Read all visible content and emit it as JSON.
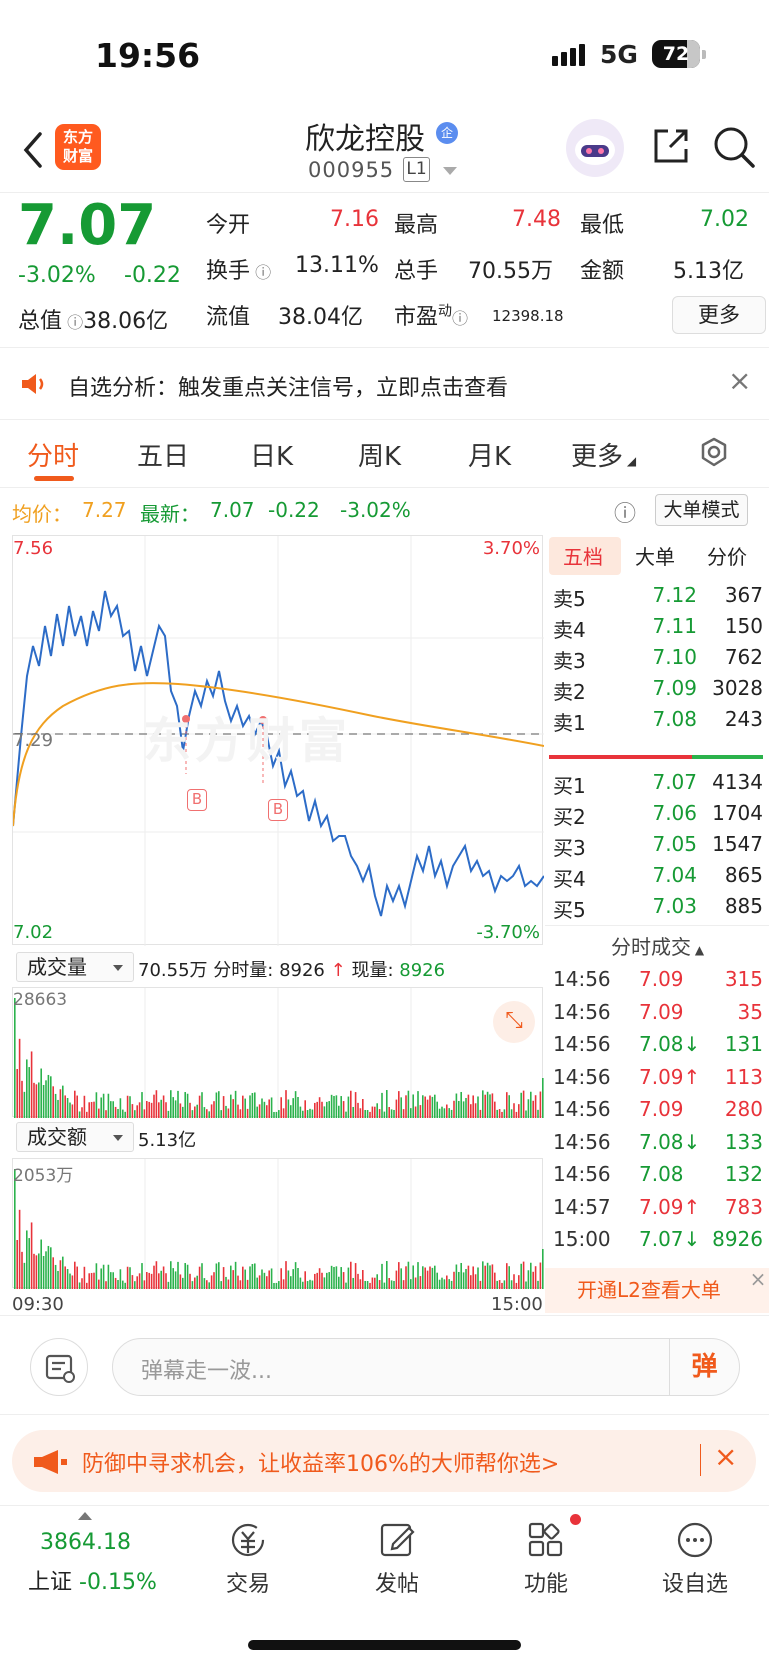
{
  "status_bar": {
    "time": "19:56",
    "network": "5G",
    "battery": "72"
  },
  "header": {
    "logo_text_1": "东方",
    "logo_text_2": "财富",
    "stock_name": "欣龙控股",
    "badge": "企",
    "stock_code": "000955",
    "level": "L1"
  },
  "quote": {
    "price": "7.07",
    "pct": "-3.02%",
    "change": "-0.22",
    "total_label": "总值",
    "total_value": "38.06亿",
    "open_label": "今开",
    "open": "7.16",
    "high_label": "最高",
    "high": "7.48",
    "low_label": "最低",
    "low": "7.02",
    "turnover_label": "换手",
    "turnover": "13.11%",
    "volume_label": "总手",
    "volume": "70.55万",
    "amount_label": "金额",
    "amount": "5.13亿",
    "float_label": "流值",
    "float_value": "38.04亿",
    "pe_label": "市盈",
    "pe_sup": "动",
    "pe": "12398.18",
    "more": "更多"
  },
  "notice": {
    "text": "自选分析：触发重点关注信号，立即点击查看"
  },
  "tabs": [
    "分时",
    "五日",
    "日K",
    "周K",
    "月K",
    "更多"
  ],
  "info": {
    "avg_label": "均价：",
    "avg": "7.27",
    "latest_label": "最新：",
    "latest": "7.07",
    "chg": "-0.22",
    "pct": "-3.02%",
    "mode": "大单模式"
  },
  "chart_labels": {
    "top_price": "7.56",
    "top_pct": "3.70%",
    "mid_price": "7.29",
    "bottom_price": "7.02",
    "bottom_pct": "-3.70%",
    "marker": "B",
    "watermark": "东方财富",
    "start_time": "09:30",
    "end_time": "15:00"
  },
  "orderbook": {
    "tabs": [
      "五档",
      "大单",
      "分价"
    ],
    "asks": [
      {
        "l": "卖5",
        "p": "7.12",
        "v": "367"
      },
      {
        "l": "卖4",
        "p": "7.11",
        "v": "150"
      },
      {
        "l": "卖3",
        "p": "7.10",
        "v": "762"
      },
      {
        "l": "卖2",
        "p": "7.09",
        "v": "3028"
      },
      {
        "l": "卖1",
        "p": "7.08",
        "v": "243"
      }
    ],
    "bids": [
      {
        "l": "买1",
        "p": "7.07",
        "v": "4134"
      },
      {
        "l": "买2",
        "p": "7.06",
        "v": "1704"
      },
      {
        "l": "买3",
        "p": "7.05",
        "v": "1547"
      },
      {
        "l": "买4",
        "p": "7.04",
        "v": "865"
      },
      {
        "l": "买5",
        "p": "7.03",
        "v": "885"
      }
    ]
  },
  "trades": {
    "title": "分时成交",
    "rows": [
      {
        "t": "14:56",
        "p": "7.09",
        "v": "315",
        "d": "",
        "c": "red"
      },
      {
        "t": "14:56",
        "p": "7.09",
        "v": "35",
        "d": "",
        "c": "red"
      },
      {
        "t": "14:56",
        "p": "7.08↓",
        "v": "131",
        "d": "",
        "c": "green"
      },
      {
        "t": "14:56",
        "p": "7.09↑",
        "v": "113",
        "d": "",
        "c": "red"
      },
      {
        "t": "14:56",
        "p": "7.09",
        "v": "280",
        "d": "",
        "c": "red"
      },
      {
        "t": "14:56",
        "p": "7.08↓",
        "v": "133",
        "d": "",
        "c": "green"
      },
      {
        "t": "14:56",
        "p": "7.08",
        "v": "132",
        "d": "",
        "c": "green"
      },
      {
        "t": "14:57",
        "p": "7.09↑",
        "v": "783",
        "d": "",
        "c": "red"
      },
      {
        "t": "15:00",
        "p": "7.07↓",
        "v": "8926",
        "d": "",
        "c": "green"
      }
    ]
  },
  "l2": "开通L2查看大单",
  "volume": {
    "select": "成交量",
    "total": "70.55万",
    "per_label": "分时量:",
    "per": "8926",
    "cur_label": "现量:",
    "cur": "8926",
    "arrow": "↑",
    "max": "28663"
  },
  "amount": {
    "select": "成交额",
    "total": "5.13亿",
    "max": "2053万"
  },
  "comment": {
    "placeholder": "弹幕走一波...",
    "send": "弹"
  },
  "ad": {
    "text": "防御中寻求机会，让收益率106%的大师帮你选>"
  },
  "bottom_nav": {
    "index_value": "3864.18",
    "index_name": "上证",
    "index_pct": "-0.15%",
    "items": [
      "交易",
      "发帖",
      "功能",
      "设自选"
    ]
  },
  "colors": {
    "up": "#e8333a",
    "down": "#169a34",
    "accent": "#f05a1c",
    "price_line": "#2d6cc7",
    "avg_line": "#f0a020"
  }
}
